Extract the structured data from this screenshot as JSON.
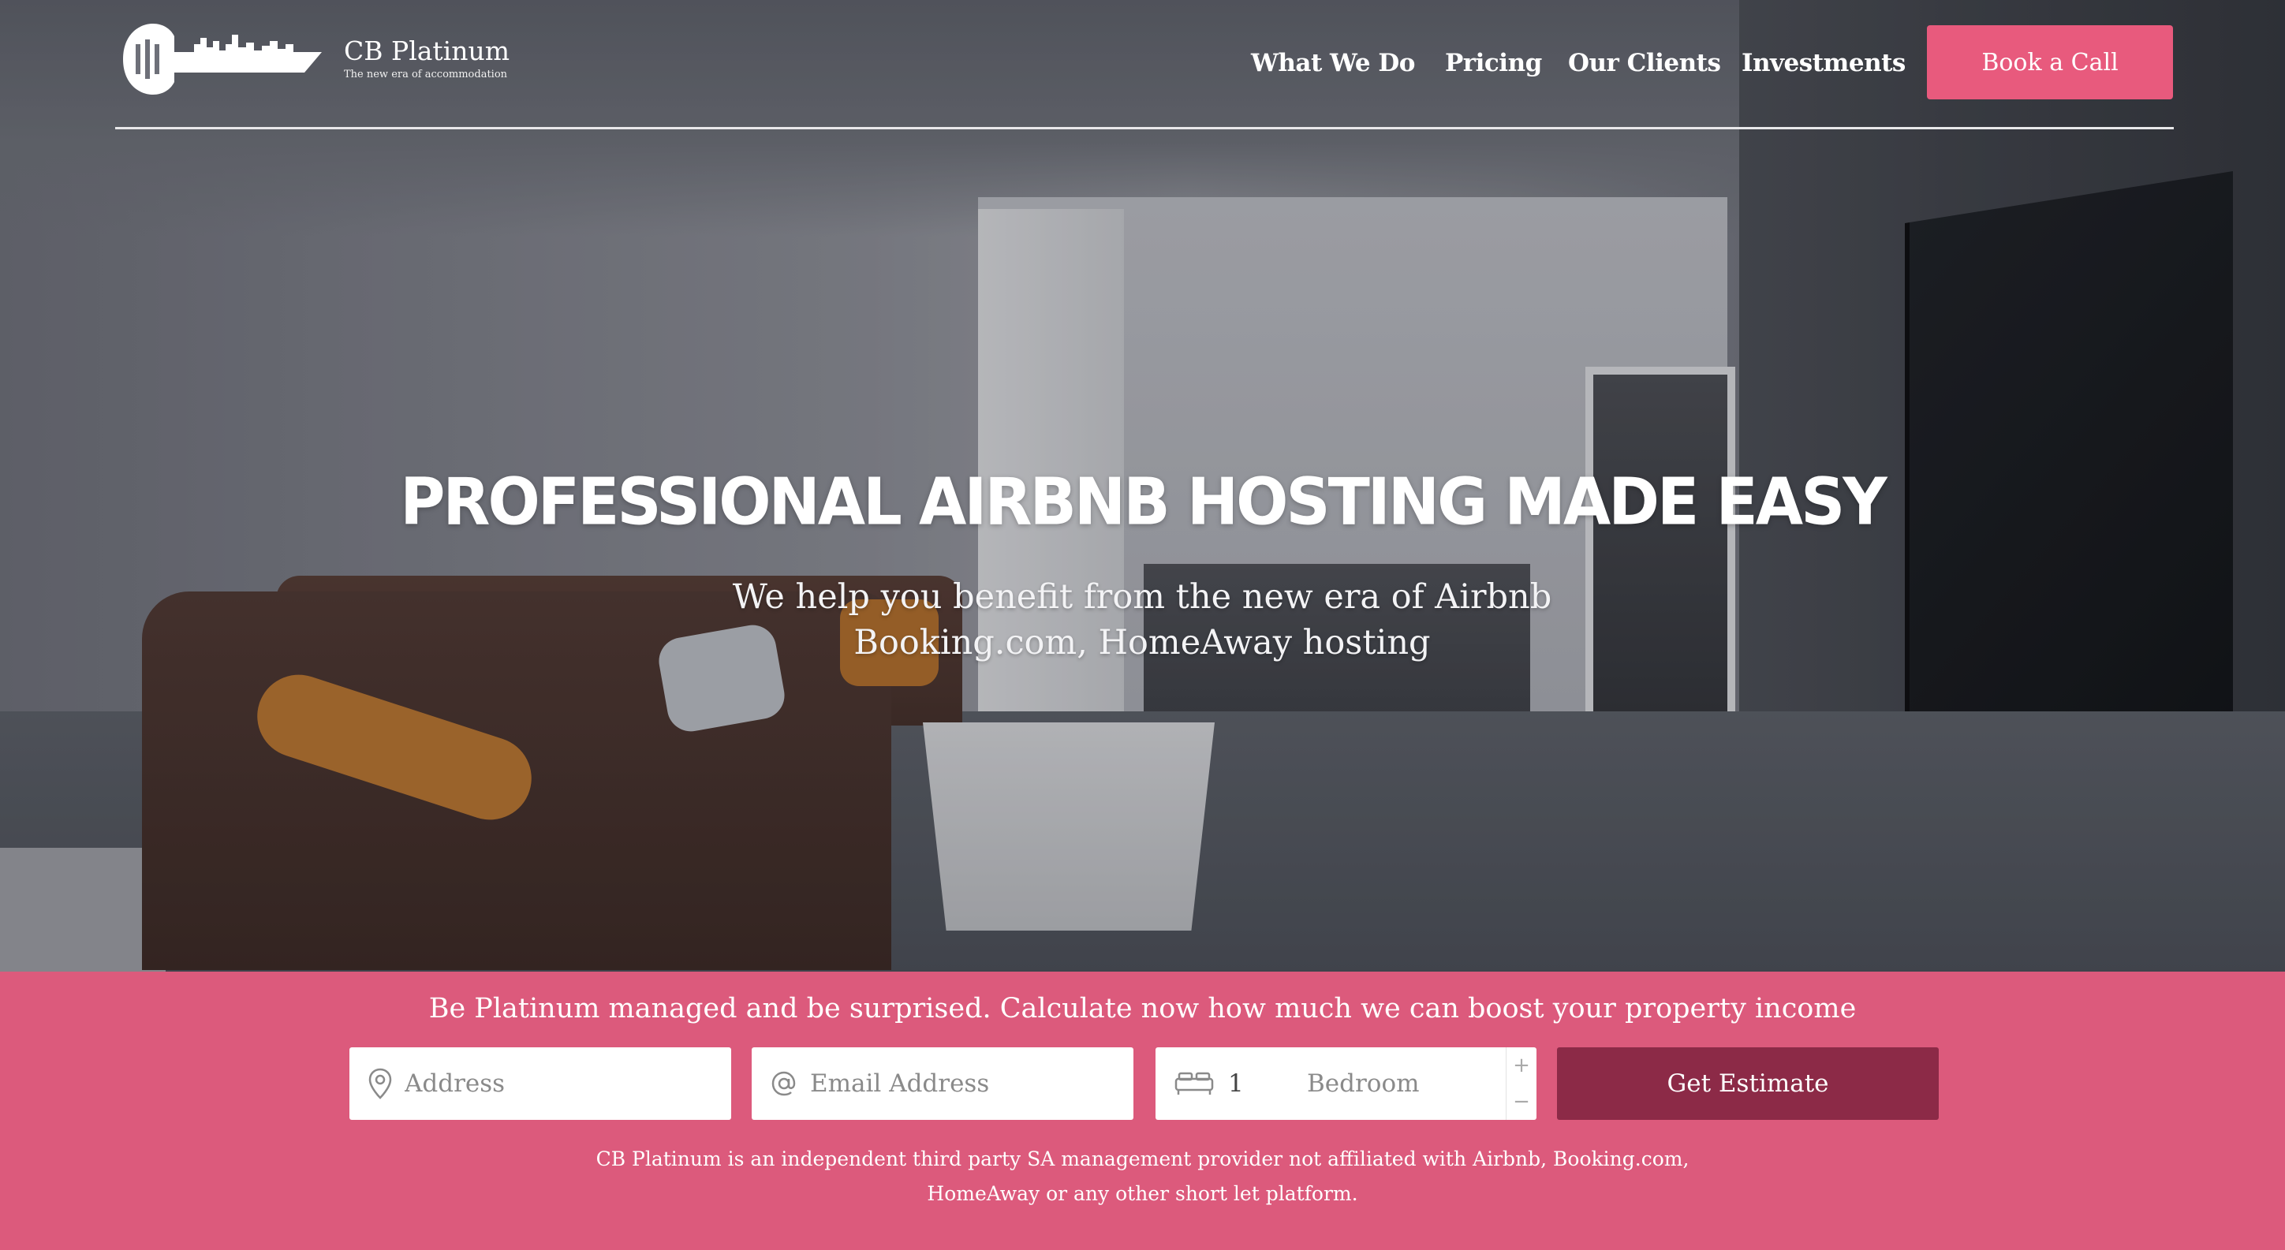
{
  "brand": {
    "name": "CB Platinum",
    "tagline": "The new era of accommodation"
  },
  "nav": {
    "items": [
      "What We Do",
      "Pricing",
      "Our Clients",
      "Investments"
    ],
    "cta": "Book a Call"
  },
  "hero": {
    "title": "PROFESSIONAL AIRBNB HOSTING MADE EASY",
    "subtitle_line1": "We help you benefit from the new era of Airbnb",
    "subtitle_line2": "Booking.com, HomeAway hosting"
  },
  "estimate": {
    "headline": "Be Platinum managed and be surprised. Calculate now how much we can boost your property income",
    "address_placeholder": "Address",
    "email_placeholder": "Email Address",
    "bedrooms_value": "1",
    "bedrooms_label": "Bedroom",
    "button": "Get Estimate",
    "disclaimer_line1": "CB Platinum is an independent third party SA management provider not affiliated with Airbnb, Booking.com,",
    "disclaimer_line2": "HomeAway or any other short let platform."
  },
  "colors": {
    "accent": "#e85a7d",
    "band": "#dc5a7c",
    "button_dark": "#8c2a47"
  },
  "icons": {
    "logo": "key-skyline-logo",
    "address": "map-pin-icon",
    "email": "at-sign-icon",
    "bedroom": "bed-icon",
    "increment": "plus-icon",
    "decrement": "minus-icon"
  }
}
